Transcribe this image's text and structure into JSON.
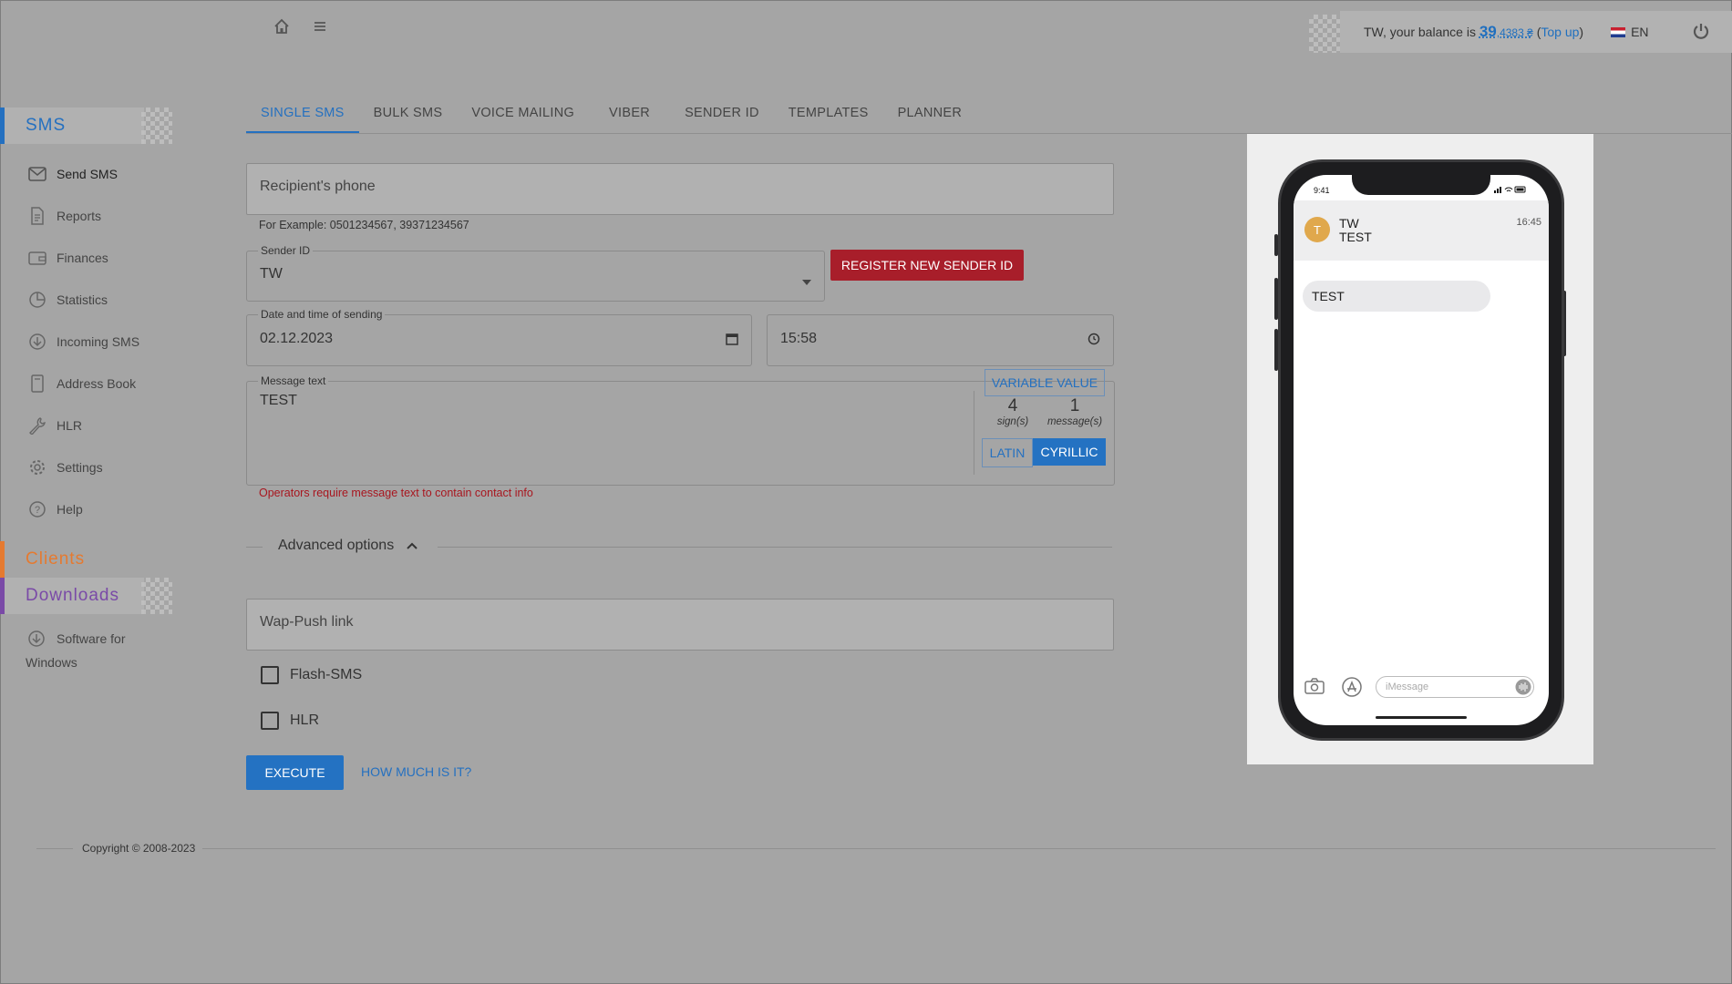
{
  "header": {
    "balance_prefix": "TW, your balance is",
    "balance_main": "39",
    "balance_fraction": ",4383 ₴",
    "topup_open": "(",
    "topup_label": "Top up",
    "topup_close": ")",
    "language": "EN"
  },
  "sidebar": {
    "sms_title": "SMS",
    "items": [
      {
        "label": "Send SMS",
        "icon": "envelope-icon"
      },
      {
        "label": "Reports",
        "icon": "document-icon"
      },
      {
        "label": "Finances",
        "icon": "wallet-icon"
      },
      {
        "label": "Statistics",
        "icon": "pie-chart-icon"
      },
      {
        "label": "Incoming SMS",
        "icon": "download-circle-icon"
      },
      {
        "label": "Address Book",
        "icon": "address-book-icon"
      },
      {
        "label": "HLR",
        "icon": "wrench-icon"
      },
      {
        "label": "Settings",
        "icon": "gear-icon"
      },
      {
        "label": "Help",
        "icon": "help-icon"
      }
    ],
    "clients_title": "Clients",
    "downloads_title": "Downloads",
    "software_line1": "Software for",
    "software_line2": "Windows"
  },
  "tabs": [
    {
      "label": "SINGLE SMS",
      "active": true
    },
    {
      "label": "BULK SMS"
    },
    {
      "label": "VOICE MAILING"
    },
    {
      "label": "VIBER"
    },
    {
      "label": "SENDER ID"
    },
    {
      "label": "TEMPLATES"
    },
    {
      "label": "PLANNER"
    }
  ],
  "form": {
    "recipient_placeholder": "Recipient's phone",
    "recipient_hint": "For Example: 0501234567, 39371234567",
    "sender_label": "Sender ID",
    "sender_value": "TW",
    "register_button": "REGISTER NEW SENDER ID",
    "date_label": "Date and time of sending",
    "date_value": "02.12.2023",
    "time_value": "15:58",
    "message_label": "Message text",
    "message_value": "TEST",
    "variable_button": "VARIABLE VALUE",
    "signs_count": "4",
    "signs_label": "sign(s)",
    "messages_count": "1",
    "messages_label": "message(s)",
    "latin_label": "LATIN",
    "cyrillic_label": "CYRILLIC",
    "error_text": "Operators require message text to contain contact info",
    "advanced_label": "Advanced options",
    "wap_placeholder": "Wap-Push link",
    "flash_label": "Flash-SMS",
    "hlr_label": "HLR",
    "execute_button": "EXECUTE",
    "price_link": "HOW MUCH IS IT?"
  },
  "preview": {
    "status_time": "9:41",
    "avatar_letter": "T",
    "sender_name": "TW",
    "sender_sub": "TEST",
    "time": "16:45",
    "bubble_text": "TEST",
    "input_placeholder": "iMessage"
  },
  "footer": {
    "copyright": "Copyright © 2008-2023"
  },
  "colors": {
    "accent": "#2470c0",
    "register_red": "#a81e2a",
    "clients_orange": "#e57a30",
    "downloads_purple": "#7a4aa7"
  }
}
